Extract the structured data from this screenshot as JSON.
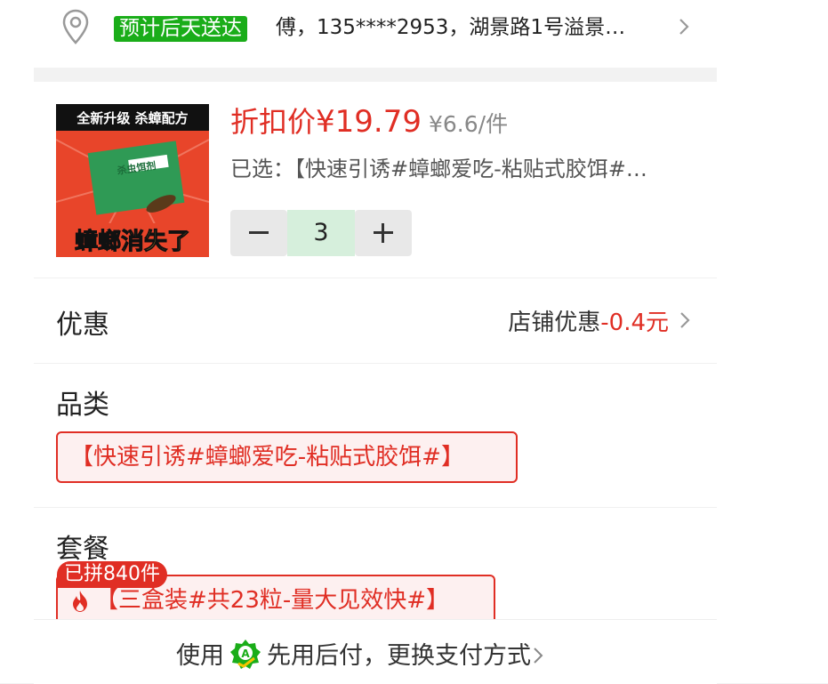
{
  "address": {
    "eta_badge": "预计后天送达",
    "text": "傅，135****2953，湖景路1号溢景…",
    "icon": "location-pin-icon"
  },
  "product": {
    "image_caption_top": "全新升级 杀蟑配方",
    "image_caption_box": "杀虫饵剂",
    "image_caption_bottom": "蟑螂消失了",
    "price_label": "折扣价",
    "price_value": "¥19.79",
    "unit_price": "¥6.6/件",
    "selected": "已选：【快速引诱#蟑螂爱吃-粘贴式胶饵#…",
    "quantity": "3"
  },
  "discount": {
    "title": "优惠",
    "label": "店铺优惠",
    "amount": "-0.4元"
  },
  "category": {
    "title": "品类",
    "option": "【快速引诱#蟑螂爱吃-粘贴式胶饵#】"
  },
  "package": {
    "title": "套餐",
    "sold_badge": "已拼840件",
    "option": "【三盒装#共23粒-量大见效快#】"
  },
  "payment": {
    "prefix": "使用",
    "text": "先用后付，更换支付方式"
  },
  "colors": {
    "accent_red": "#e02e24",
    "eta_green": "#1aad19",
    "qty_bg": "#d6efdc"
  }
}
